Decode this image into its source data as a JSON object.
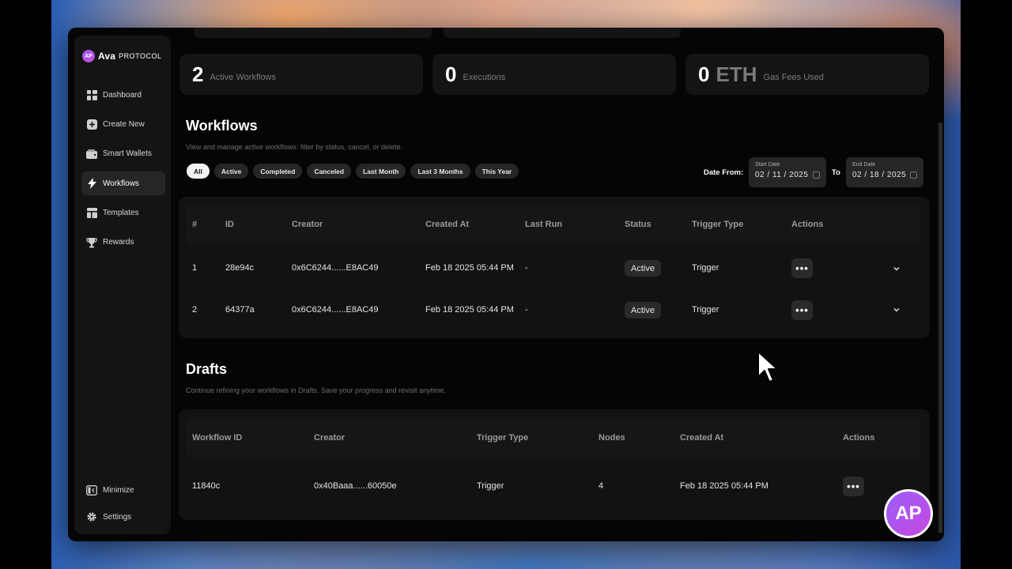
{
  "brand": {
    "logo_mark": "AP",
    "name": "Ava",
    "name_sub": "PROTOCOL",
    "accent": "#9b5cf6"
  },
  "sidebar": {
    "items": [
      {
        "label": "Dashboard",
        "icon": "dashboard-icon"
      },
      {
        "label": "Create New",
        "icon": "plus-icon"
      },
      {
        "label": "Smart Wallets",
        "icon": "wallet-icon"
      },
      {
        "label": "Workflows",
        "icon": "bolt-icon",
        "active": true
      },
      {
        "label": "Templates",
        "icon": "template-icon"
      },
      {
        "label": "Rewards",
        "icon": "trophy-icon"
      }
    ],
    "bottom": [
      {
        "label": "Minimize",
        "icon": "minimize-icon"
      },
      {
        "label": "Settings",
        "icon": "gear-icon"
      }
    ]
  },
  "stats": [
    {
      "value": "2",
      "unit": "",
      "label": "Active Workflows"
    },
    {
      "value": "0",
      "unit": "",
      "label": "Executions"
    },
    {
      "value": "0",
      "unit": "ETH",
      "label": "Gas Fees Used"
    }
  ],
  "workflows": {
    "title": "Workflows",
    "subtitle": "View and manage active workflows: filter by status, cancel, or delete.",
    "filters": [
      "All",
      "Active",
      "Completed",
      "Canceled",
      "Last Month",
      "Last 3 Months",
      "This Year"
    ],
    "active_filter": "All",
    "date_from_label": "Date From:",
    "to_label": "To",
    "start_date": {
      "label": "Start Date",
      "value": "02 / 11 / 2025"
    },
    "end_date": {
      "label": "End Date",
      "value": "02 / 18 / 2025"
    },
    "columns": [
      "#",
      "ID",
      "Creator",
      "Created At",
      "Last Run",
      "Status",
      "Trigger Type",
      "Actions"
    ],
    "rows": [
      {
        "num": "1",
        "id": "28e94c",
        "creator": "0x6C6244......E8AC49",
        "created_at": "Feb 18 2025 05:44 PM",
        "last_run": "-",
        "status": "Active",
        "trigger": "Trigger",
        "actions": "•••"
      },
      {
        "num": "2",
        "id": "64377a",
        "creator": "0x6C6244......E8AC49",
        "created_at": "Feb 18 2025 05:44 PM",
        "last_run": "-",
        "status": "Active",
        "trigger": "Trigger",
        "actions": "•••"
      }
    ]
  },
  "drafts": {
    "title": "Drafts",
    "subtitle": "Continue refining your workflows in Drafts. Save your progress and revisit anytime.",
    "columns": [
      "Workflow ID",
      "Creator",
      "Trigger Type",
      "Nodes",
      "Created At",
      "Actions"
    ],
    "rows": [
      {
        "id": "11840c",
        "creator": "0x40Baaa......60050e",
        "trigger": "Trigger",
        "nodes": "4",
        "created_at": "Feb 18 2025 05:44 PM",
        "actions": "•••"
      }
    ]
  },
  "corner_badge": "AP"
}
